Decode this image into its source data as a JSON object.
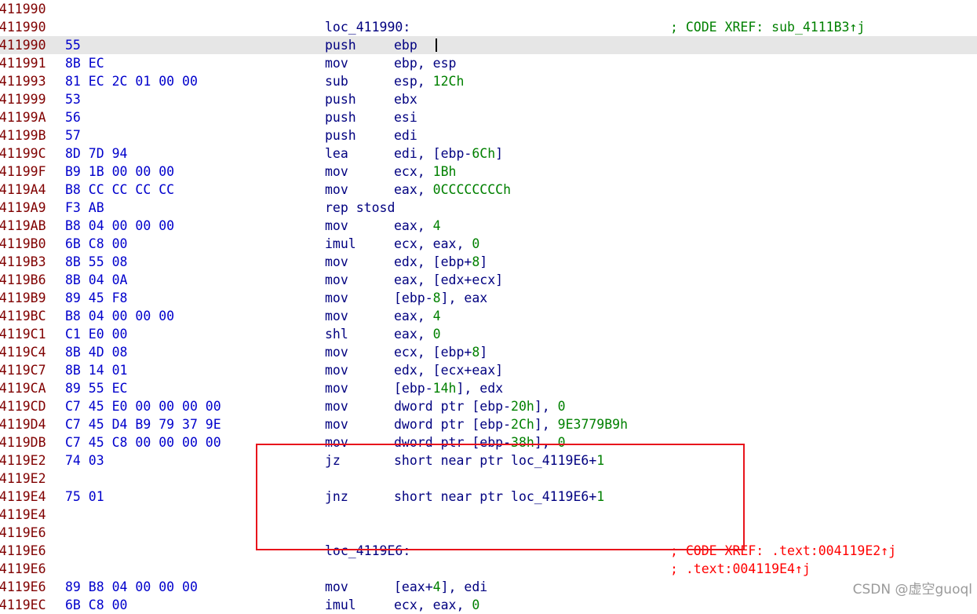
{
  "rows": [
    {
      "addr": "0411990",
      "bytes": "",
      "kind": "blank"
    },
    {
      "addr": "0411990",
      "bytes": "",
      "kind": "label",
      "label": "loc_411990:",
      "comment": "; CODE XREF: sub_4111B3↑j"
    },
    {
      "addr": "0411990",
      "bytes": "55",
      "kind": "ins",
      "mnem": "push",
      "ops": [
        {
          "t": "ebp"
        }
      ],
      "highlight": true
    },
    {
      "addr": "0411991",
      "bytes": "8B EC",
      "kind": "ins",
      "mnem": "mov",
      "ops": [
        {
          "t": "ebp, esp"
        }
      ]
    },
    {
      "addr": "0411993",
      "bytes": "81 EC 2C 01 00 00",
      "kind": "ins",
      "mnem": "sub",
      "ops": [
        {
          "t": "esp, "
        },
        {
          "t": "12Ch",
          "n": true
        }
      ]
    },
    {
      "addr": "0411999",
      "bytes": "53",
      "kind": "ins",
      "mnem": "push",
      "ops": [
        {
          "t": "ebx"
        }
      ]
    },
    {
      "addr": "041199A",
      "bytes": "56",
      "kind": "ins",
      "mnem": "push",
      "ops": [
        {
          "t": "esi"
        }
      ]
    },
    {
      "addr": "041199B",
      "bytes": "57",
      "kind": "ins",
      "mnem": "push",
      "ops": [
        {
          "t": "edi"
        }
      ]
    },
    {
      "addr": "041199C",
      "bytes": "8D 7D 94",
      "kind": "ins",
      "mnem": "lea",
      "ops": [
        {
          "t": "edi, [ebp-"
        },
        {
          "t": "6Ch",
          "n": true
        },
        {
          "t": "]"
        }
      ]
    },
    {
      "addr": "041199F",
      "bytes": "B9 1B 00 00 00",
      "kind": "ins",
      "mnem": "mov",
      "ops": [
        {
          "t": "ecx, "
        },
        {
          "t": "1Bh",
          "n": true
        }
      ]
    },
    {
      "addr": "04119A4",
      "bytes": "B8 CC CC CC CC",
      "kind": "ins",
      "mnem": "mov",
      "ops": [
        {
          "t": "eax, "
        },
        {
          "t": "0CCCCCCCCh",
          "n": true
        }
      ]
    },
    {
      "addr": "04119A9",
      "bytes": "F3 AB",
      "kind": "ins",
      "mnem": "rep stosd",
      "ops": []
    },
    {
      "addr": "04119AB",
      "bytes": "B8 04 00 00 00",
      "kind": "ins",
      "mnem": "mov",
      "ops": [
        {
          "t": "eax, "
        },
        {
          "t": "4",
          "n": true
        }
      ]
    },
    {
      "addr": "04119B0",
      "bytes": "6B C8 00",
      "kind": "ins",
      "mnem": "imul",
      "ops": [
        {
          "t": "ecx, eax, "
        },
        {
          "t": "0",
          "n": true
        }
      ]
    },
    {
      "addr": "04119B3",
      "bytes": "8B 55 08",
      "kind": "ins",
      "mnem": "mov",
      "ops": [
        {
          "t": "edx, [ebp+"
        },
        {
          "t": "8",
          "n": true
        },
        {
          "t": "]"
        }
      ]
    },
    {
      "addr": "04119B6",
      "bytes": "8B 04 0A",
      "kind": "ins",
      "mnem": "mov",
      "ops": [
        {
          "t": "eax, [edx+ecx]"
        }
      ]
    },
    {
      "addr": "04119B9",
      "bytes": "89 45 F8",
      "kind": "ins",
      "mnem": "mov",
      "ops": [
        {
          "t": "[ebp-"
        },
        {
          "t": "8",
          "n": true
        },
        {
          "t": "], eax"
        }
      ]
    },
    {
      "addr": "04119BC",
      "bytes": "B8 04 00 00 00",
      "kind": "ins",
      "mnem": "mov",
      "ops": [
        {
          "t": "eax, "
        },
        {
          "t": "4",
          "n": true
        }
      ]
    },
    {
      "addr": "04119C1",
      "bytes": "C1 E0 00",
      "kind": "ins",
      "mnem": "shl",
      "ops": [
        {
          "t": "eax, "
        },
        {
          "t": "0",
          "n": true
        }
      ]
    },
    {
      "addr": "04119C4",
      "bytes": "8B 4D 08",
      "kind": "ins",
      "mnem": "mov",
      "ops": [
        {
          "t": "ecx, [ebp+"
        },
        {
          "t": "8",
          "n": true
        },
        {
          "t": "]"
        }
      ]
    },
    {
      "addr": "04119C7",
      "bytes": "8B 14 01",
      "kind": "ins",
      "mnem": "mov",
      "ops": [
        {
          "t": "edx, [ecx+eax]"
        }
      ]
    },
    {
      "addr": "04119CA",
      "bytes": "89 55 EC",
      "kind": "ins",
      "mnem": "mov",
      "ops": [
        {
          "t": "[ebp-"
        },
        {
          "t": "14h",
          "n": true
        },
        {
          "t": "], edx"
        }
      ]
    },
    {
      "addr": "04119CD",
      "bytes": "C7 45 E0 00 00 00 00",
      "kind": "ins",
      "mnem": "mov",
      "ops": [
        {
          "t": "dword ptr [ebp-"
        },
        {
          "t": "20h",
          "n": true
        },
        {
          "t": "], "
        },
        {
          "t": "0",
          "n": true
        }
      ]
    },
    {
      "addr": "04119D4",
      "bytes": "C7 45 D4 B9 79 37 9E",
      "kind": "ins",
      "mnem": "mov",
      "ops": [
        {
          "t": "dword ptr [ebp-"
        },
        {
          "t": "2Ch",
          "n": true
        },
        {
          "t": "], "
        },
        {
          "t": "9E3779B9h",
          "n": true
        }
      ]
    },
    {
      "addr": "04119DB",
      "bytes": "C7 45 C8 00 00 00 00",
      "kind": "ins",
      "mnem": "mov",
      "ops": [
        {
          "t": "dword ptr [ebp-"
        },
        {
          "t": "38h",
          "n": true
        },
        {
          "t": "], "
        },
        {
          "t": "0",
          "n": true
        }
      ]
    },
    {
      "addr": "04119E2",
      "bytes": "74 03",
      "kind": "ins",
      "mnem": "jz",
      "ops": [
        {
          "t": "short near ptr loc_4119E6+"
        },
        {
          "t": "1",
          "n": true
        }
      ]
    },
    {
      "addr": "04119E2",
      "bytes": "",
      "kind": "blank"
    },
    {
      "addr": "04119E4",
      "bytes": "75 01",
      "kind": "ins",
      "mnem": "jnz",
      "ops": [
        {
          "t": "short near ptr loc_4119E6+"
        },
        {
          "t": "1",
          "n": true
        }
      ]
    },
    {
      "addr": "04119E4",
      "bytes": "",
      "kind": "blank"
    },
    {
      "addr": "04119E6",
      "bytes": "",
      "kind": "blank"
    },
    {
      "addr": "04119E6",
      "bytes": "",
      "kind": "label",
      "label": "loc_4119E6:",
      "comment": "; CODE XREF: .text:004119E2↑j",
      "comment_red": true
    },
    {
      "addr": "04119E6",
      "bytes": "",
      "kind": "comment",
      "comment": "; .text:004119E4↑j",
      "comment_red": true
    },
    {
      "addr": "04119E6",
      "bytes": "89 B8 04 00 00 00",
      "kind": "ins",
      "mnem": "mov",
      "ops": [
        {
          "t": "[eax+"
        },
        {
          "t": "4",
          "n": true
        },
        {
          "t": "], edi"
        }
      ]
    },
    {
      "addr": "04119EC",
      "bytes": "6B C8 00",
      "kind": "ins",
      "mnem": "imul",
      "ops": [
        {
          "t": "ecx, eax, "
        },
        {
          "t": "0",
          "n": true
        }
      ]
    }
  ],
  "watermark": "CSDN @虚空guoql",
  "colors": {
    "address": "#800000",
    "bytes": "#0000cc",
    "code": "#000080",
    "number": "#008000",
    "comment": "#008000",
    "annotation_box": "#e8141c",
    "highlight_row": "#e6e6e6"
  }
}
